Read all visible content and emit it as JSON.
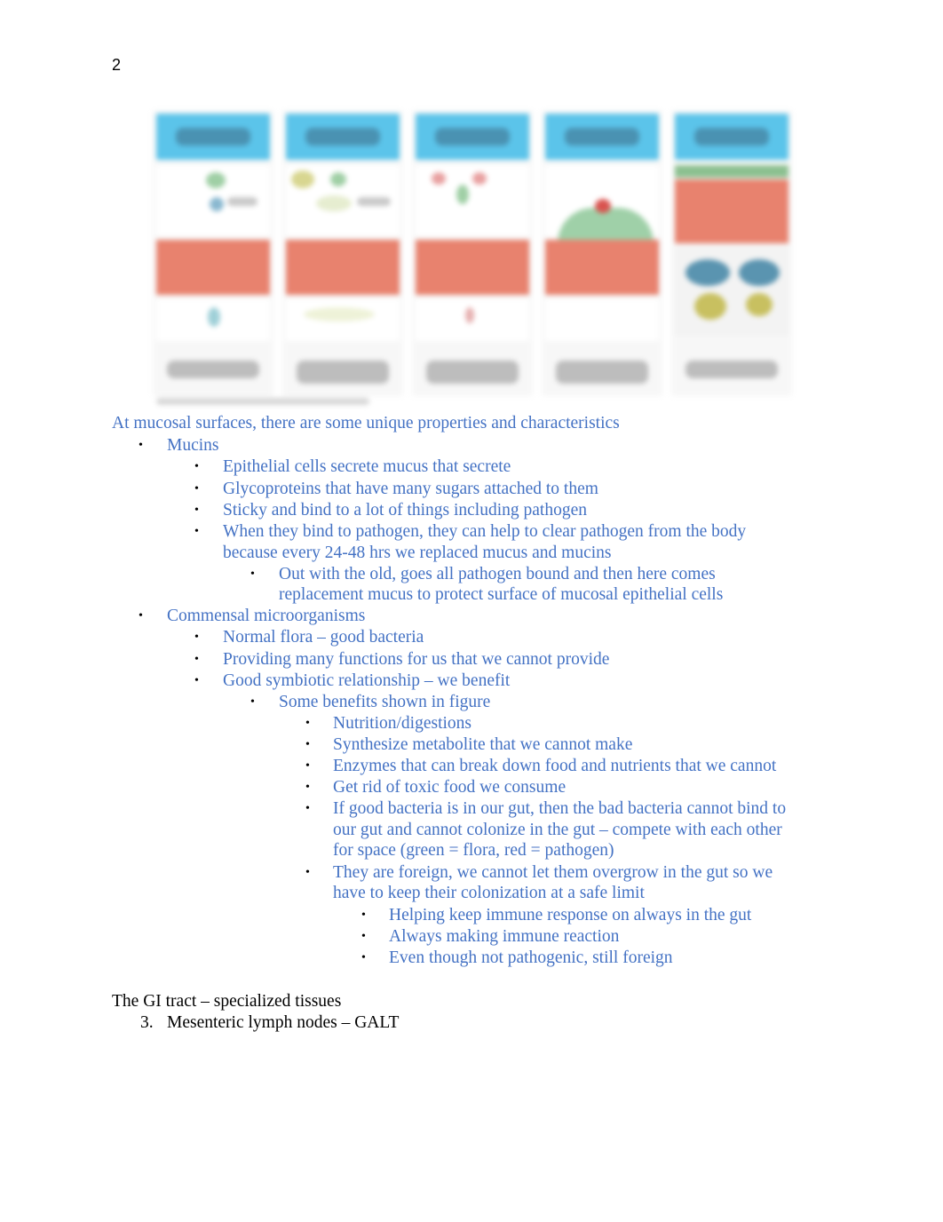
{
  "page_number": "2",
  "figure": {
    "description": "Blurred figure: five panels with blue header bars, white illustration areas, red epithelial bands, and grey caption text",
    "panel_count": 5,
    "colors": {
      "header": "#5bc4ea",
      "band": "#e8826e",
      "caption": "#bdbdbd",
      "flora": "#8cc8a0",
      "pathogen": "#d9534f"
    }
  },
  "notes": {
    "intro": "At mucosal surfaces, there are some unique properties and characteristics",
    "mucins": {
      "label": "Mucins",
      "items": [
        "Epithelial cells secrete mucus that secrete",
        "Glycoproteins that have many sugars attached to them",
        "Sticky and bind to a lot of things including pathogen",
        "When they bind to pathogen, they can help to clear pathogen from the body",
        "because every 24-48 hrs we replaced mucus and mucins"
      ],
      "sub": [
        "Out with the old, goes all pathogen bound and then here comes",
        "replacement mucus to protect surface of mucosal epithelial cells"
      ]
    },
    "commensal": {
      "label": "Commensal microorganisms",
      "items": [
        "Normal flora – good bacteria",
        "Providing many functions for us that we cannot provide",
        "Good symbiotic relationship – we benefit"
      ],
      "benefits_label": "Some benefits shown in figure",
      "benefits": [
        "Nutrition/digestions",
        "Synthesize metabolite that we cannot make",
        "Enzymes that can break down food and nutrients that we cannot",
        "Get rid of toxic food we consume",
        "If good bacteria is in our gut, then the bad bacteria cannot bind to",
        "our gut and cannot colonize in the gut – compete with each other",
        "for space (green = flora, red = pathogen)",
        "They are foreign, we cannot let them overgrow in the gut so we",
        "have to keep their colonization at a safe limit"
      ],
      "immune": [
        "Helping keep immune response on always in the gut",
        "Always making immune reaction",
        "Even though not pathogenic, still foreign"
      ]
    },
    "gi_heading": "The GI tract – specialized tissues",
    "gi_item_number": "3.",
    "gi_item": "Mesenteric lymph nodes – GALT"
  },
  "colors": {
    "note_text": "#4472c4",
    "body_text": "#000000"
  }
}
